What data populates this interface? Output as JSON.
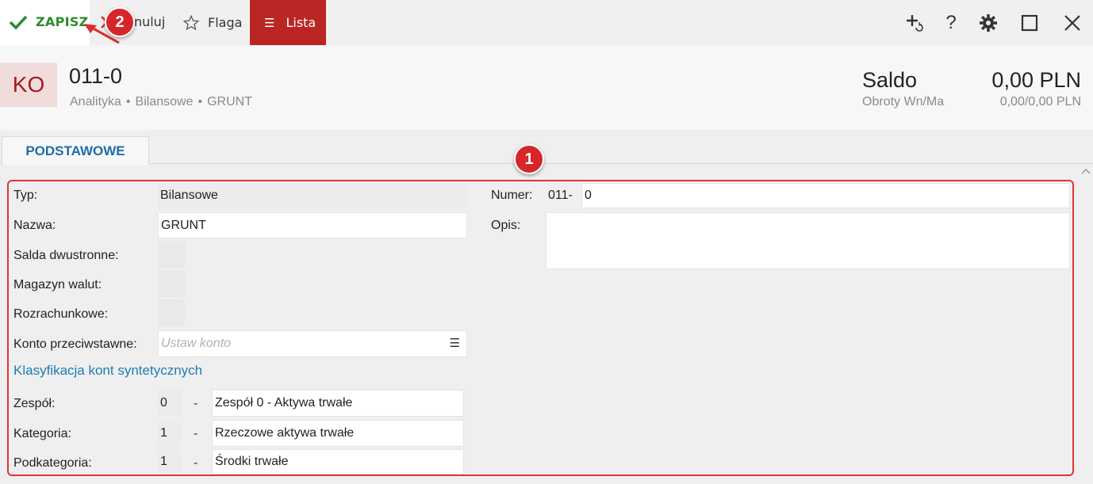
{
  "toolbar": {
    "save_label": "ZAPISZ",
    "cancel_label": "Anuluj",
    "flag_label": "Flaga",
    "list_label": "Lista",
    "list_color": "#b92623",
    "save_color": "#2e8b2e"
  },
  "header": {
    "avatar": "KO",
    "title": "011-0",
    "breadcrumb": [
      "Analityka",
      "Bilansowe",
      "GRUNT"
    ],
    "saldo_label": "Saldo",
    "saldo_value": "0,00 PLN",
    "obroty_label": "Obroty Wn/Ma",
    "obroty_value": "0,00/0,00 PLN"
  },
  "tabs": [
    {
      "label": "PODSTAWOWE",
      "active": true
    }
  ],
  "form": {
    "typ_label": "Typ:",
    "typ_value": "Bilansowe",
    "nazwa_label": "Nazwa:",
    "nazwa_value": "GRUNT",
    "salda_label": "Salda dwustronne:",
    "magazyn_label": "Magazyn walut:",
    "rozrachunkowe_label": "Rozrachunkowe:",
    "konto_label": "Konto przeciwstawne:",
    "konto_placeholder": "Ustaw konto",
    "klasyfikacja_link": "Klasyfikacja kont syntetycznych",
    "zespol_label": "Zespół:",
    "zespol_code": "0",
    "zespol_name": "Zespół 0 - Aktywa trwałe",
    "kategoria_label": "Kategoria:",
    "kategoria_code": "1",
    "kategoria_name": "Rzeczowe aktywa trwałe",
    "podkategoria_label": "Podkategoria:",
    "podkategoria_code": "1",
    "podkategoria_name": "Środki trwałe",
    "dash": "-",
    "numer_label": "Numer:",
    "numer_prefix": "011-",
    "numer_value": "0",
    "opis_label": "Opis:",
    "opis_value": ""
  },
  "markers": {
    "one": "1",
    "two": "2"
  },
  "icons": [
    "check-icon",
    "close-icon",
    "star-icon",
    "menu-icon",
    "add-refresh-icon",
    "help-icon",
    "gear-icon",
    "maximize-icon",
    "close-window-icon",
    "chevron-up-icon"
  ]
}
